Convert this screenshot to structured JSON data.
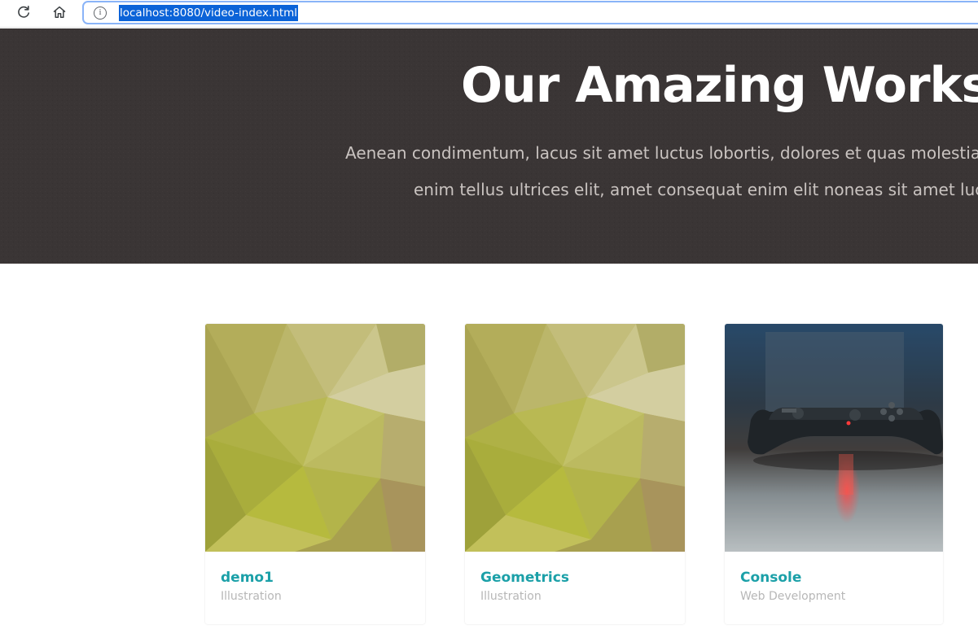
{
  "browser": {
    "url": "localhost:8080/video-index.html",
    "icons": [
      "reload-icon",
      "home-icon",
      "info-icon"
    ]
  },
  "hero": {
    "title": "Our Amazing Works",
    "title_dot": ".",
    "subtitle_line1": "Aenean condimentum, lacus sit amet luctus lobortis, dolores et quas molestias",
    "subtitle_line2": "enim tellus ultrices elit, amet consequat enim elit noneas sit amet luct",
    "accent_color": "#1aa3ad",
    "background_color": "#3a3535"
  },
  "works": [
    {
      "title": "demo1",
      "category": "Illustration",
      "thumbnail": "geometric-pattern"
    },
    {
      "title": "Geometrics",
      "category": "Illustration",
      "thumbnail": "geometric-pattern"
    },
    {
      "title": "Console",
      "category": "Web Development",
      "thumbnail": "game-controller-photo"
    }
  ],
  "colors": {
    "card_title": "#1ba0a8",
    "card_category": "#b7b7b7"
  }
}
